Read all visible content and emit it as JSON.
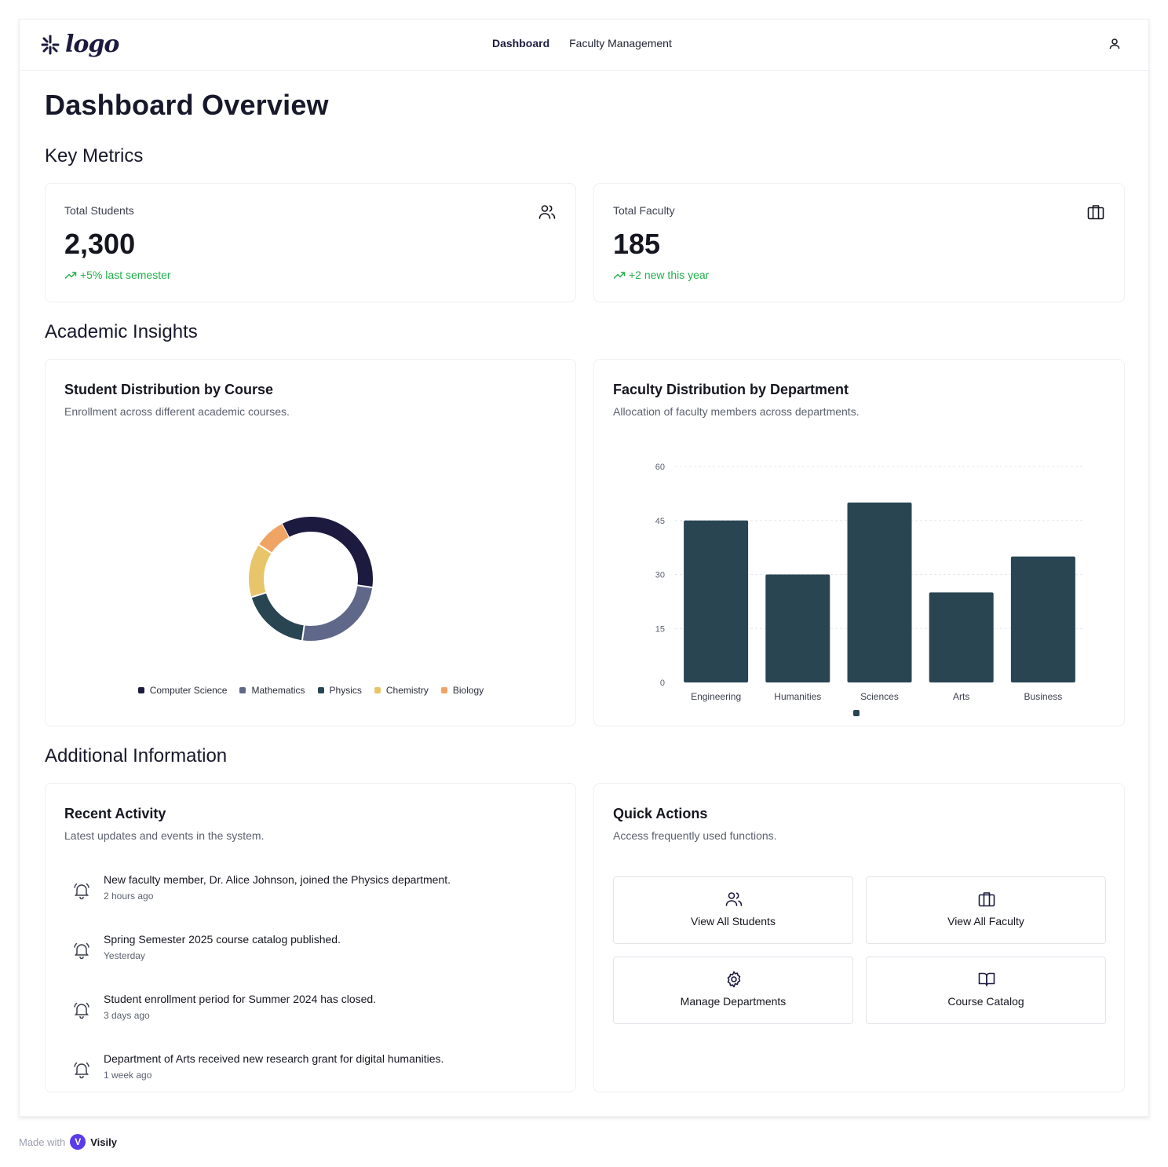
{
  "header": {
    "logo_text": "logo",
    "nav": [
      {
        "label": "Dashboard",
        "active": true
      },
      {
        "label": "Faculty Management",
        "active": false
      }
    ],
    "user_icon": "user-icon"
  },
  "page_title": "Dashboard Overview",
  "sections": {
    "key_metrics": "Key Metrics",
    "academic_insights": "Academic Insights",
    "additional_information": "Additional Information"
  },
  "metrics": [
    {
      "label": "Total Students",
      "value": "2,300",
      "trend": "+5% last semester",
      "icon": "users-icon"
    },
    {
      "label": "Total Faculty",
      "value": "185",
      "trend": "+2 new this year",
      "icon": "briefcase-icon"
    }
  ],
  "student_chart": {
    "title": "Student Distribution by Course",
    "subtitle": "Enrollment across different academic courses."
  },
  "faculty_chart": {
    "title": "Faculty Distribution by Department",
    "subtitle": "Allocation of faculty members across departments."
  },
  "chart_data": [
    {
      "type": "pie",
      "variant": "donut",
      "categories": [
        "Computer Science",
        "Mathematics",
        "Physics",
        "Chemistry",
        "Biology"
      ],
      "values": [
        35,
        25,
        18,
        14,
        8
      ],
      "colors": [
        "#1c1a3f",
        "#5f6889",
        "#294552",
        "#e8c56a",
        "#f0a464"
      ],
      "legend": "bottom"
    },
    {
      "type": "bar",
      "categories": [
        "Engineering",
        "Humanities",
        "Sciences",
        "Arts",
        "Business"
      ],
      "values": [
        45,
        30,
        50,
        25,
        35
      ],
      "ylim": [
        0,
        60
      ],
      "yticks": [
        0,
        15,
        30,
        45,
        60
      ],
      "grid": true,
      "color": "#294552"
    }
  ],
  "recent_activity": {
    "title": "Recent Activity",
    "subtitle": "Latest updates and events in the system.",
    "items": [
      {
        "text": "New faculty member, Dr. Alice Johnson, joined the Physics department.",
        "time": "2 hours ago"
      },
      {
        "text": "Spring Semester 2025 course catalog published.",
        "time": "Yesterday"
      },
      {
        "text": "Student enrollment period for Summer 2024 has closed.",
        "time": "3 days ago"
      },
      {
        "text": "Department of Arts received new research grant for digital humanities.",
        "time": "1 week ago"
      }
    ]
  },
  "quick_actions": {
    "title": "Quick Actions",
    "subtitle": "Access frequently used functions.",
    "items": [
      {
        "label": "View All Students",
        "icon": "users-icon"
      },
      {
        "label": "View All Faculty",
        "icon": "briefcase-icon"
      },
      {
        "label": "Manage Departments",
        "icon": "gear-icon"
      },
      {
        "label": "Course Catalog",
        "icon": "book-open-icon"
      }
    ]
  },
  "footer": {
    "made_with": "Made with",
    "brand": "Visily",
    "brand_initial": "V"
  },
  "colors": {
    "accent": "#1c1a3f",
    "trend_up": "#22b14c",
    "bar": "#294552"
  }
}
